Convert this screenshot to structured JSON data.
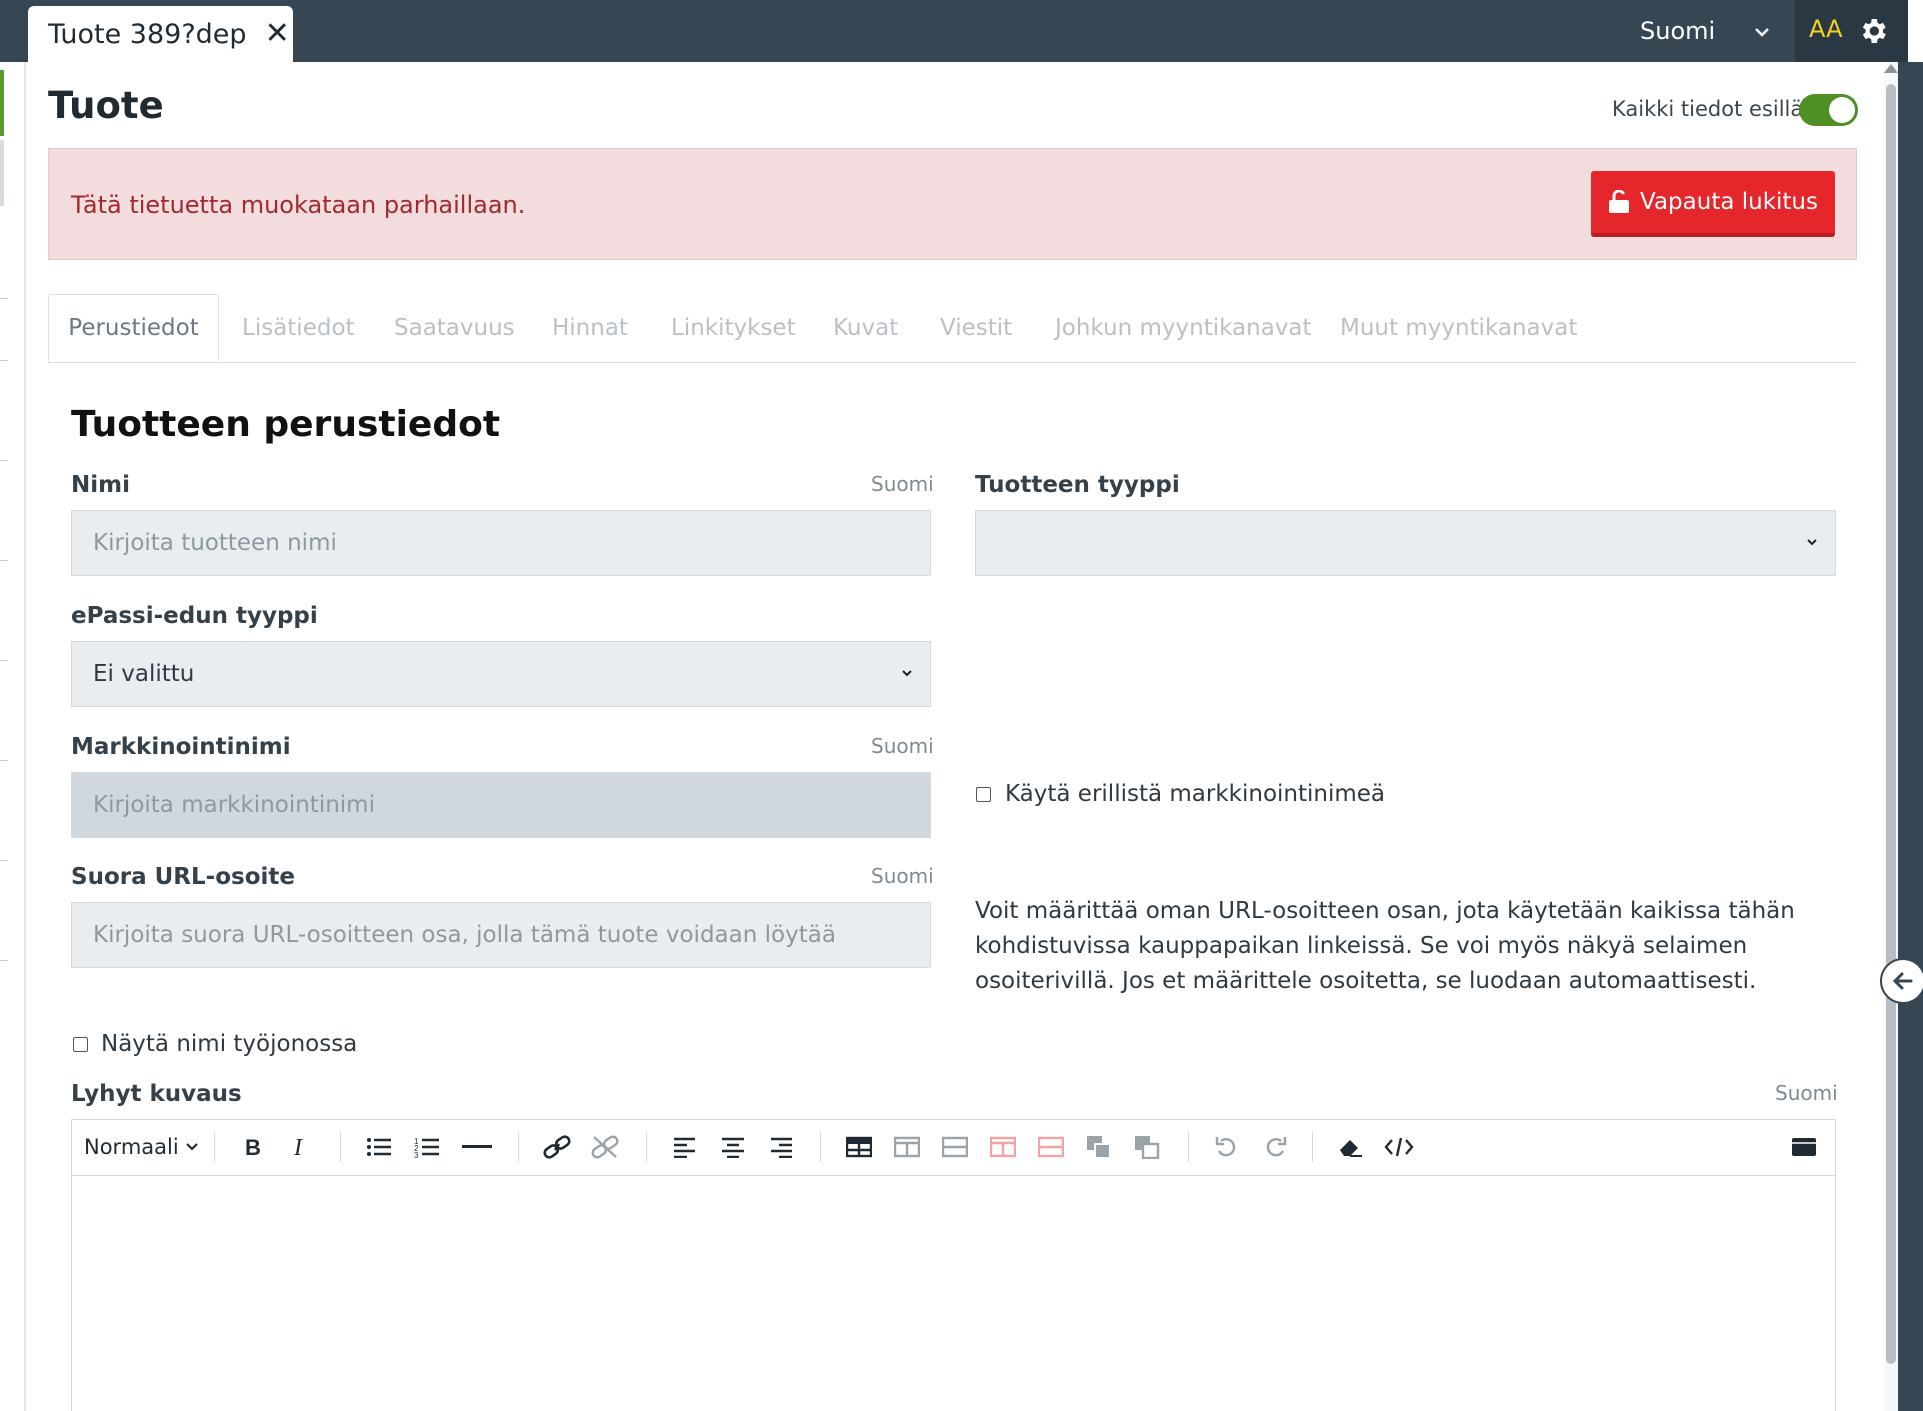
{
  "topbar": {
    "doc_tab_title": "Tuote 389?dep",
    "language": "Suomi",
    "font_size_label": "AA"
  },
  "page": {
    "title": "Tuote",
    "show_all_label": "Kaikki tiedot esillä",
    "show_all_on": true
  },
  "alert": {
    "message": "Tätä tietuetta muokataan parhaillaan.",
    "button_label": "Vapauta lukitus"
  },
  "tabs": [
    {
      "label": "Perustiedot",
      "active": true
    },
    {
      "label": "Lisätiedot"
    },
    {
      "label": "Saatavuus"
    },
    {
      "label": "Hinnat"
    },
    {
      "label": "Linkitykset"
    },
    {
      "label": "Kuvat"
    },
    {
      "label": "Viestit"
    },
    {
      "label": "Johkun myyntikanavat"
    },
    {
      "label": "Muut myyntikanavat"
    }
  ],
  "form": {
    "section_title": "Tuotteen perustiedot",
    "name": {
      "label": "Nimi",
      "lang": "Suomi",
      "placeholder": "Kirjoita tuotteen nimi"
    },
    "product_type": {
      "label": "Tuotteen tyyppi",
      "value": ""
    },
    "epassi": {
      "label": "ePassi-edun tyyppi",
      "value": "Ei valittu"
    },
    "marketing": {
      "label": "Markkinointinimi",
      "lang": "Suomi",
      "placeholder": "Kirjoita markkinointinimi",
      "checkbox_label": "Käytä erillistä markkinointinimeä",
      "checked": false
    },
    "url": {
      "label": "Suora URL-osoite",
      "lang": "Suomi",
      "placeholder": "Kirjoita suora URL-osoitteen osa, jolla tämä tuote voidaan löytää",
      "help": "Voit määrittää oman URL-osoitteen osan, jota käytetään kaikissa tähän kohdistuvissa kauppapaikan linkeissä. Se voi myös näkyä selaimen osoiterivillä. Jos et määrittele osoitetta, se luodaan automaattisesti."
    },
    "show_name_queue": {
      "label": "Näytä nimi työjonossa",
      "checked": false
    },
    "short_desc": {
      "label": "Lyhyt kuvaus",
      "lang": "Suomi",
      "format": "Normaali"
    }
  },
  "colors": {
    "topbar": "#364753",
    "accent_yellow": "#f2d321",
    "toggle_green": "#4f8f25",
    "alert_bg": "#f2dcdd",
    "alert_text": "#a02a2f",
    "danger_button": "#e5262b"
  },
  "icons": [
    "close-icon",
    "chevron-down-icon",
    "gear-icon",
    "unlock-icon",
    "bold-icon",
    "italic-icon",
    "bullet-list-icon",
    "numbered-list-icon",
    "horizontal-rule-icon",
    "link-icon",
    "unlink-icon",
    "align-left-icon",
    "align-center-icon",
    "align-right-icon",
    "table-icon",
    "insert-column-icon",
    "insert-row-icon",
    "delete-column-icon",
    "delete-row-icon",
    "merge-cells-icon",
    "split-cells-icon",
    "undo-icon",
    "redo-icon",
    "eraser-icon",
    "code-icon",
    "fullscreen-icon",
    "collapse-arrow-icon"
  ]
}
